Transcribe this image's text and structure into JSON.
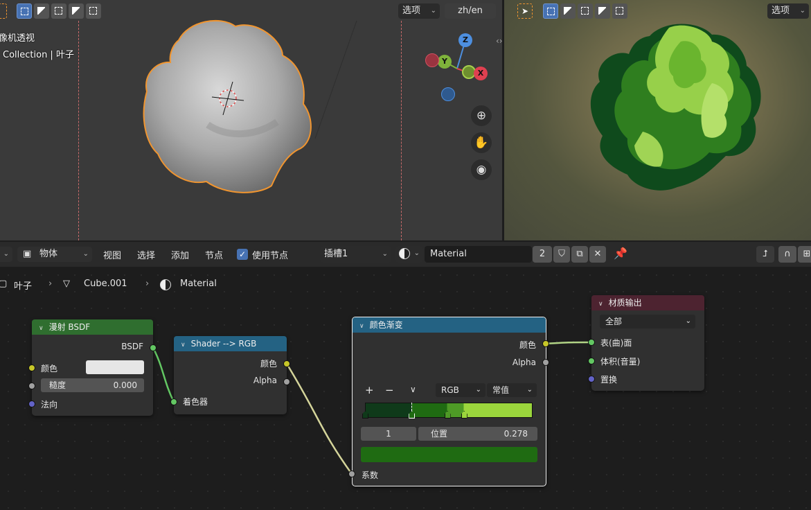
{
  "left_viewport": {
    "overlay_line1": "像机透视",
    "overlay_line2": "Collection | 叶子",
    "options_label": "选项",
    "lang_button": "zh/en",
    "gizmo": {
      "z": "Z",
      "y": "Y",
      "x": "X"
    }
  },
  "right_viewport": {
    "options_label": "选项"
  },
  "node_header": {
    "mode_label": "物体",
    "menu": [
      "视图",
      "选择",
      "添加",
      "节点"
    ],
    "use_nodes_label": "使用节点",
    "use_nodes_checked": true,
    "slot_label": "插槽1",
    "material_name": "Material",
    "user_count": "2"
  },
  "breadcrumb": {
    "object": "叶子",
    "mesh": "Cube.001",
    "material": "Material"
  },
  "nodes": {
    "diffuse": {
      "title": "漫射 BSDF",
      "output": "BSDF",
      "color_label": "颜色",
      "roughness_label": "糙度",
      "roughness_value": "0.000",
      "normal_label": "法向"
    },
    "shader_rgb": {
      "title": "Shader --> RGB",
      "out_color": "颜色",
      "out_alpha": "Alpha",
      "in_shader": "着色器"
    },
    "color_ramp": {
      "title": "颜色渐变",
      "out_color": "颜色",
      "out_alpha": "Alpha",
      "plus": "+",
      "minus": "−",
      "color_mode": "RGB",
      "interpolation": "常值",
      "stop_index": "1",
      "position_label": "位置",
      "position_value": "0.278",
      "selected_color": "#1f6b12",
      "fac_label": "系数",
      "stops": [
        {
          "pos": 0.0,
          "color": "#0f3a1a"
        },
        {
          "pos": 0.278,
          "color": "#1f6b12"
        },
        {
          "pos": 0.49,
          "color": "#4e9a26"
        },
        {
          "pos": 0.59,
          "color": "#9bd63c"
        }
      ]
    },
    "material_output": {
      "title": "材质输出",
      "target": "全部",
      "surface": "表(曲)面",
      "volume": "体积(音量)",
      "displacement": "置换"
    }
  },
  "colors": {
    "shader_header": "#2f6e2f",
    "converter_header": "#246283",
    "output_header": "#4d2330",
    "selection_orange": "#f1952f"
  }
}
